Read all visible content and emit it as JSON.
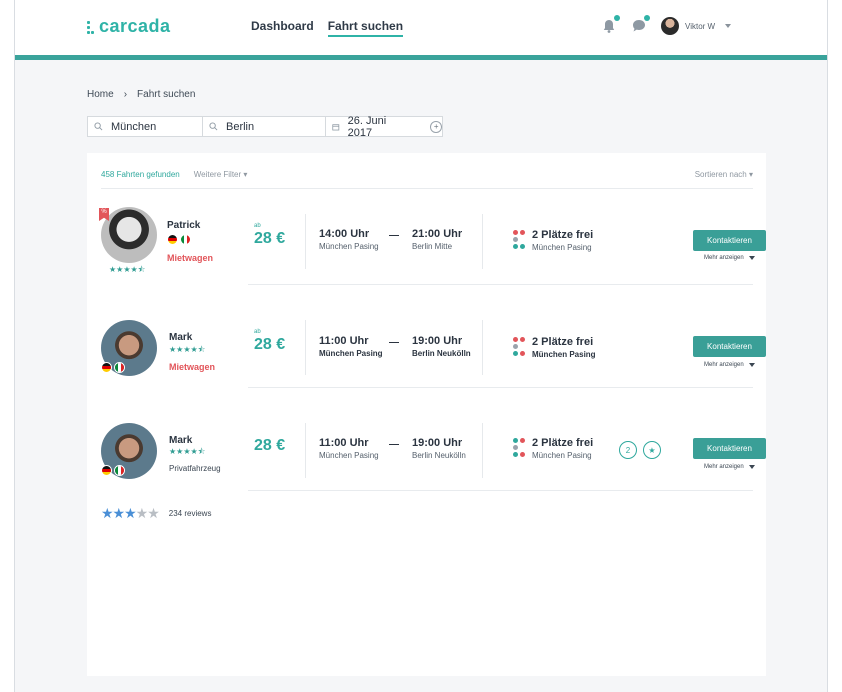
{
  "brand": {
    "name": "carcada",
    "color": "#2fb3a7"
  },
  "nav": {
    "items": [
      {
        "label": "Dashboard"
      },
      {
        "label": "Fahrt suchen",
        "active": true
      }
    ]
  },
  "user": {
    "name": "Viktor W"
  },
  "breadcrumb": {
    "home": "Home",
    "separator": "›",
    "current": "Fahrt suchen"
  },
  "search": {
    "from": "München",
    "to": "Berlin",
    "date": "26. Juni 2017"
  },
  "filters": {
    "count_label": "458 Fahrten gefunden",
    "more_filters": "Weitere Filter",
    "sort": "Sortieren nach"
  },
  "rides": [
    {
      "name": "Patrick",
      "tag": "Mietwagen",
      "rating": 4.5,
      "badge": "%",
      "price_prefix": "ab",
      "price": "28 €",
      "depart_time": "14:00 Uhr",
      "depart_place": "München Pasing",
      "arrive_time": "21:00 Uhr",
      "arrive_place": "Berlin Mitte",
      "seats": "2 Plätze frei",
      "pickup": "München Pasing",
      "contact_label": "Kontaktieren",
      "more_label": "Mehr anzeigen"
    },
    {
      "name": "Mark",
      "tag": "Mietwagen",
      "rating": 4.5,
      "price_prefix": "ab",
      "price": "28 €",
      "depart_time": "11:00 Uhr",
      "depart_place": "München Pasing",
      "arrive_time": "19:00 Uhr",
      "arrive_place": "Berlin Neukölln",
      "seats": "2 Plätze frei",
      "pickup": "München Pasing",
      "contact_label": "Kontaktieren",
      "more_label": "Mehr anzeigen"
    },
    {
      "name": "Mark",
      "tag": "Privatfahrzeug",
      "rating": 4.5,
      "price": "28 €",
      "depart_time": "11:00 Uhr",
      "depart_place": "München Pasing",
      "arrive_time": "19:00 Uhr",
      "arrive_place": "Berlin Neukölln",
      "seats": "2 Plätze frei",
      "pickup": "München Pasing",
      "extra_badge": "2",
      "contact_label": "Kontaktieren",
      "more_label": "Mehr anzeigen"
    }
  ],
  "reviews": {
    "rating": 3,
    "max": 5,
    "count_label": "234 reviews"
  },
  "colors": {
    "accent": "#3aa39b",
    "price": "#2fa89d",
    "tag_red": "#e2555a",
    "star_blue": "#4a8fd6"
  }
}
